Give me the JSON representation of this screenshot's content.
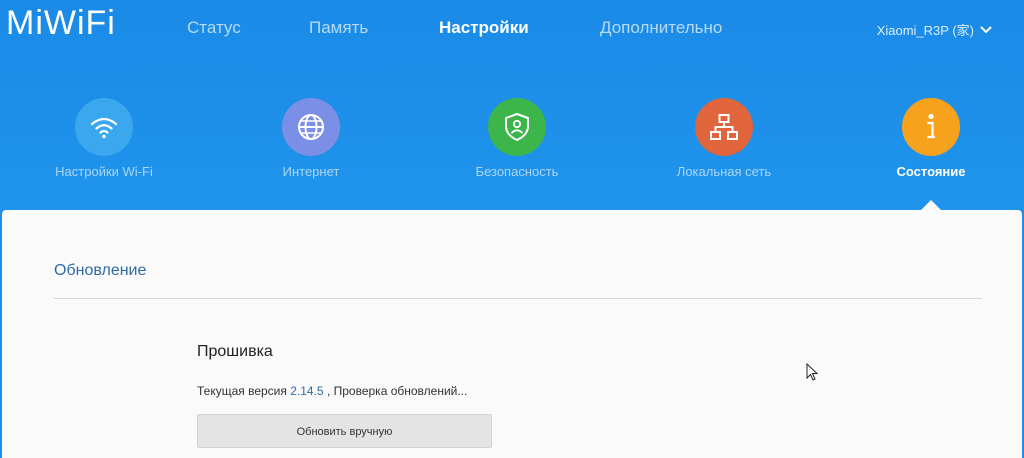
{
  "brand": {
    "logo_text": "MiWiFi"
  },
  "nav": {
    "items": [
      {
        "label": "Статус"
      },
      {
        "label": "Память"
      },
      {
        "label": "Настройки"
      },
      {
        "label": "Дополнительно"
      }
    ],
    "active": "Настройки"
  },
  "router": {
    "name": "Xiaomi_R3P (家)",
    "icon": "chevron-down-icon"
  },
  "tiles": [
    {
      "label": "Настройки Wi-Fi",
      "icon": "wifi-icon",
      "color": "#3aa7ee"
    },
    {
      "label": "Интернет",
      "icon": "globe-icon",
      "color": "#7b8fe6"
    },
    {
      "label": "Безопасность",
      "icon": "shield-icon",
      "color": "#3cb64a"
    },
    {
      "label": "Локальная сеть",
      "icon": "network-icon",
      "color": "#e0643c"
    },
    {
      "label": "Состояние",
      "icon": "info-icon",
      "color": "#f7a21c"
    }
  ],
  "active_tile": "Состояние",
  "panel": {
    "section_title": "Обновление",
    "firmware": {
      "title": "Прошивка",
      "current_version_label": "Текущая версия",
      "version": "2.14.5",
      "status_text": ", Проверка обновлений...",
      "update_button": "Обновить вручную"
    }
  },
  "colors": {
    "header_blue": "#1f8ee8",
    "link_blue": "#2f6aa7",
    "panel_bg": "#fafafa"
  }
}
